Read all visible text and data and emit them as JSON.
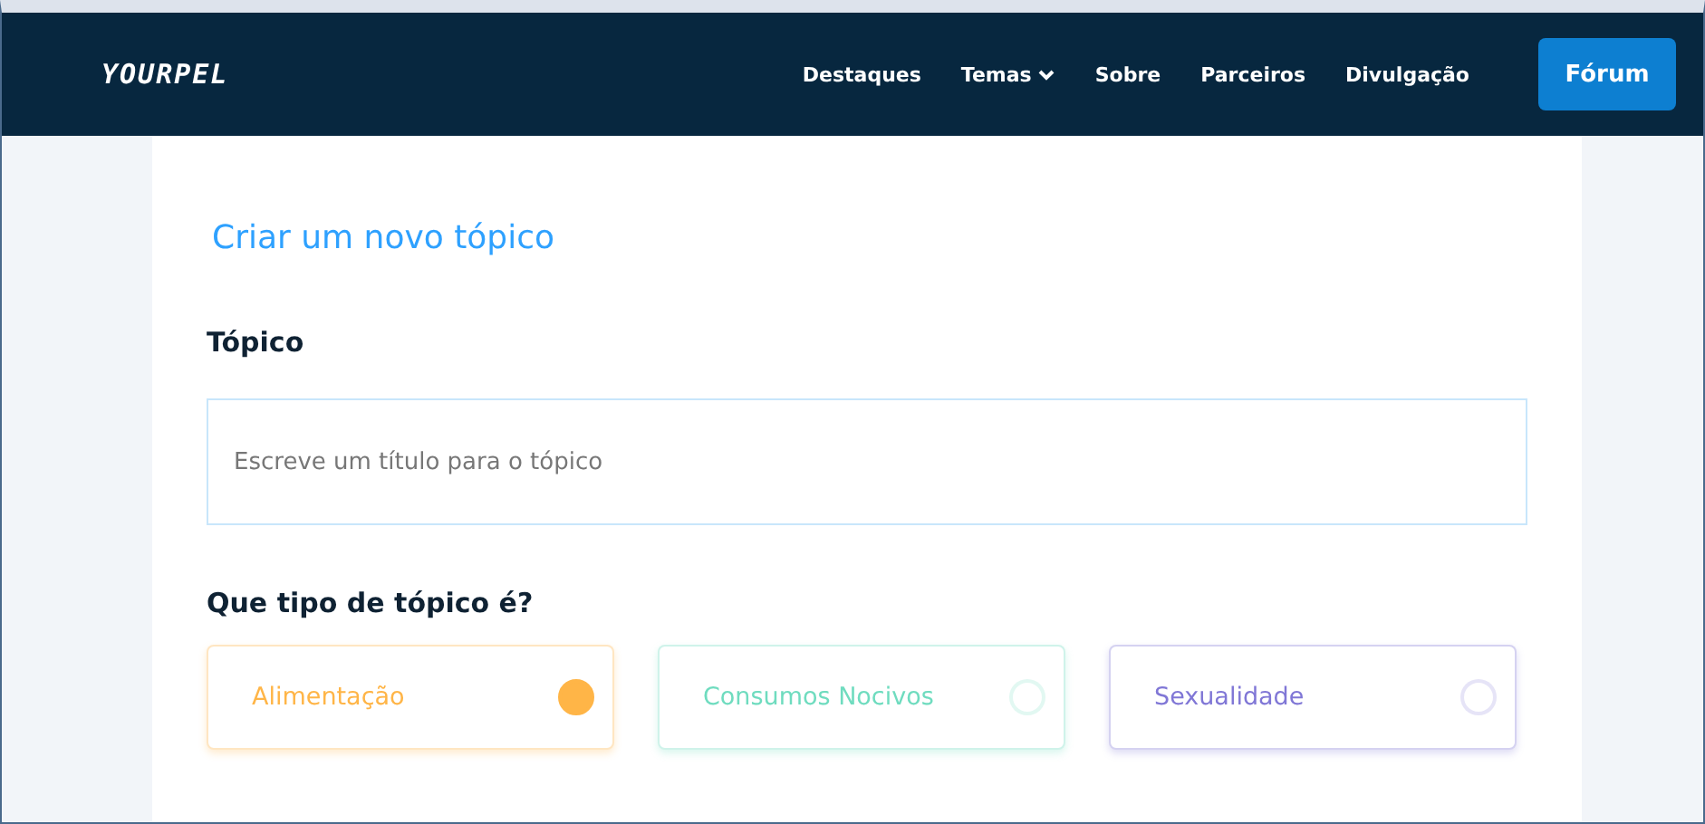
{
  "logo": "YOURPEL",
  "nav": {
    "items": [
      {
        "label": "Destaques",
        "dropdown": false
      },
      {
        "label": "Temas",
        "dropdown": true
      },
      {
        "label": "Sobre",
        "dropdown": false
      },
      {
        "label": "Parceiros",
        "dropdown": false
      },
      {
        "label": "Divulgação",
        "dropdown": false
      }
    ],
    "button": "Fórum"
  },
  "form": {
    "title": "Criar um novo tópico",
    "topic_label": "Tópico",
    "topic_field": {
      "placeholder": "Escreve um título para o tópico"
    },
    "type_label": "Que tipo de tópico é?",
    "types": [
      {
        "label": "Alimentação",
        "color": "#ffb547",
        "selected": true
      },
      {
        "label": "Consumos Nocivos",
        "color": "#6fdcbf",
        "selected": false
      },
      {
        "label": "Sexualidade",
        "color": "#8077d6",
        "selected": false
      }
    ]
  }
}
